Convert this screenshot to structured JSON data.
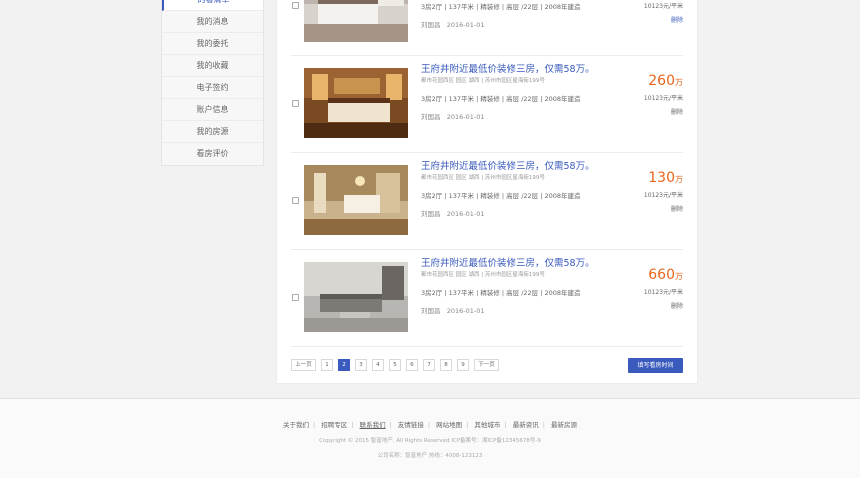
{
  "sidebar": {
    "items": [
      {
        "label": "的看清单"
      },
      {
        "label": "我的消息"
      },
      {
        "label": "我的委托"
      },
      {
        "label": "我的收藏"
      },
      {
        "label": "电子签约"
      },
      {
        "label": "账户信息"
      },
      {
        "label": "我的房源"
      },
      {
        "label": "看房评价"
      }
    ]
  },
  "listings": [
    {
      "title": "",
      "address": "",
      "specs": "3房2厅 | 137平米 | 精装修 | 高层 /22层 | 2008年建造",
      "agent": "刘国昌",
      "date": "2016-01-01",
      "price": "",
      "price_unit": "",
      "unit_price": "10123元/平米",
      "delete_label": "删除"
    },
    {
      "title": "王府井附近最低价装修三房，仅需58万。",
      "address": "都市花园西区  园区 湖西 | 苏州市园区星海街199号",
      "specs": "3房2厅 | 137平米 | 精装修 | 高层 /22层 | 2008年建造",
      "agent": "刘国昌",
      "date": "2016-01-01",
      "price": "260",
      "price_unit": "万",
      "unit_price": "10123元/平米",
      "delete_label": "删除"
    },
    {
      "title": "王府井附近最低价装修三房，仅需58万。",
      "address": "都市花园西区  园区 湖西 | 苏州市园区星海街199号",
      "specs": "3房2厅 | 137平米 | 精装修 | 高层 /22层 | 2008年建造",
      "agent": "刘国昌",
      "date": "2016-01-01",
      "price": "130",
      "price_unit": "万",
      "unit_price": "10123元/平米",
      "delete_label": "删除"
    },
    {
      "title": "王府井附近最低价装修三房，仅需58万。",
      "address": "都市花园西区  园区 湖西 | 苏州市园区星海街199号",
      "specs": "3房2厅 | 137平米 | 精装修 | 高层 /22层 | 2008年建造",
      "agent": "刘国昌",
      "date": "2016-01-01",
      "price": "660",
      "price_unit": "万",
      "unit_price": "10123元/平米",
      "delete_label": "删除"
    }
  ],
  "pagination": {
    "prev": "上一页",
    "pages": [
      "1",
      "2",
      "3",
      "4",
      "5",
      "6",
      "7",
      "8",
      "9"
    ],
    "current": "2",
    "next": "下一页"
  },
  "fill_button": "填写看房时间",
  "footer": {
    "links": [
      "关于我们",
      "招聘专区",
      "联系我们",
      "友情链接",
      "网站地图",
      "其他城市",
      "最新资讯",
      "最新房源"
    ],
    "selected_link": "联系我们",
    "copyright": "Copyright © 2015 智富地产. All Rights Reserved ICP备案号：湘ICP备12345678号-9",
    "company": "公司名称：智富地产  热线：4008-123123"
  },
  "colors": {
    "accent": "#3a5bbd",
    "price": "#e8641b"
  }
}
